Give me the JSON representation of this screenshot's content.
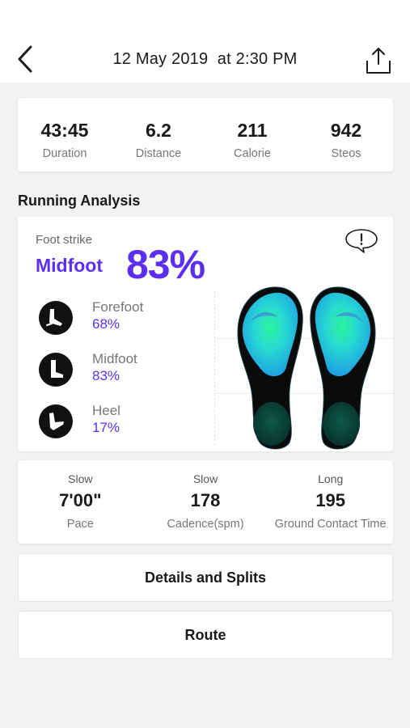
{
  "header": {
    "title": "12 May 2019  at 2:30 PM",
    "back_icon": "chevron-left-icon",
    "share_icon": "share-icon"
  },
  "summary": [
    {
      "value": "43:45",
      "label": "Duration"
    },
    {
      "value": "6.2",
      "label": "Distance"
    },
    {
      "value": "211",
      "label": "Calorie"
    },
    {
      "value": "942",
      "label": "Steos"
    }
  ],
  "analysis": {
    "section_title": "Running Analysis",
    "foot_strike_label": "Foot strike",
    "foot_strike_type": "Midfoot",
    "foot_strike_percent": "83%",
    "info_icon": "speech-bubble-exclamation-icon",
    "strikes": [
      {
        "name": "Forefoot",
        "value": "68%",
        "icon": "forefoot-icon"
      },
      {
        "name": "Midfoot",
        "value": "83%",
        "icon": "midfoot-icon"
      },
      {
        "name": "Heel",
        "value": "17%",
        "icon": "heel-icon"
      }
    ]
  },
  "metrics": [
    {
      "level": "Slow",
      "value": "7'00\"",
      "label": "Pace"
    },
    {
      "level": "Slow",
      "value": "178",
      "label": "Cadence(spm)"
    },
    {
      "level": "Long",
      "value": "195",
      "label": "Ground Contact Time"
    }
  ],
  "buttons": {
    "details": "Details and Splits",
    "route": "Route"
  },
  "colors": {
    "accent": "#5a2ff0",
    "background": "#f2f2f2",
    "card": "#ffffff"
  }
}
